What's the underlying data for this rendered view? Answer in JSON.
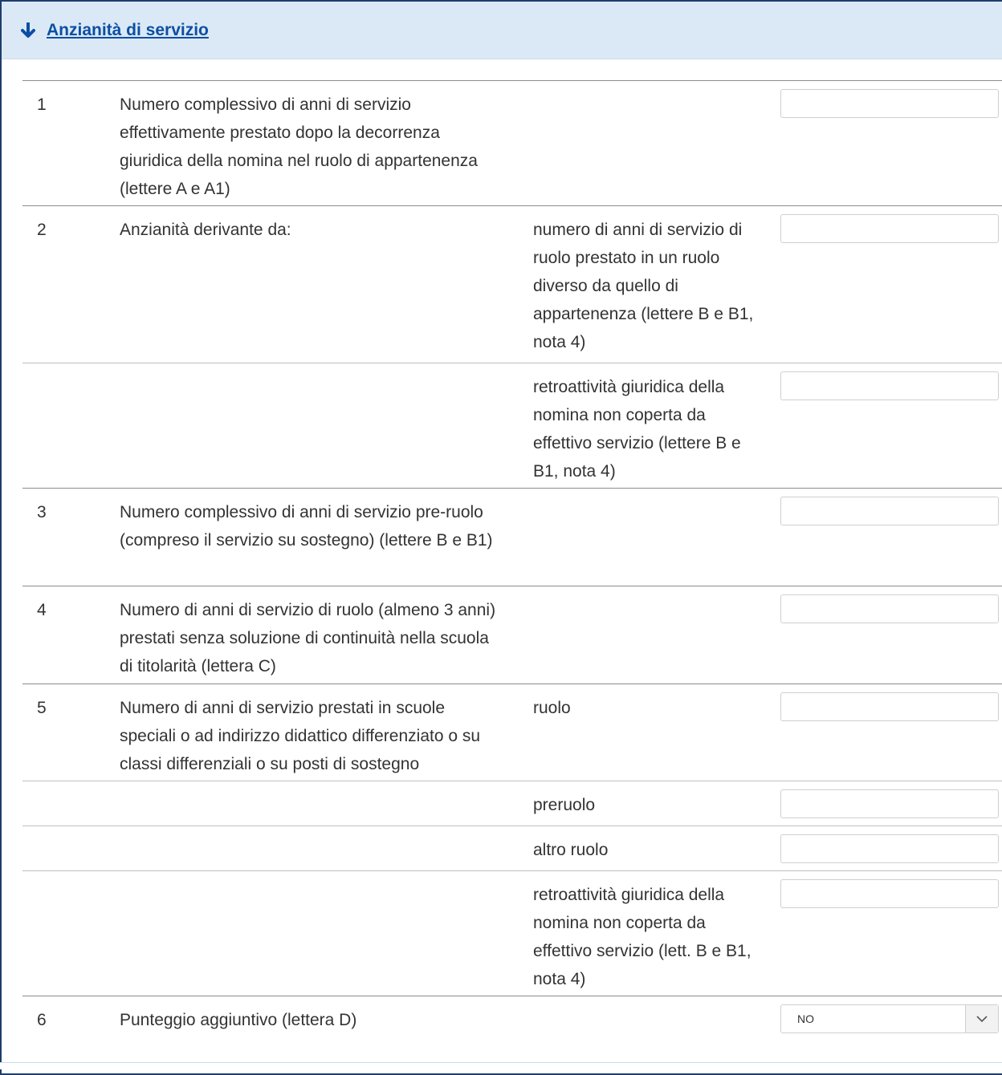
{
  "section": {
    "title": "Anzianità di servizio"
  },
  "rows": [
    {
      "num": "1",
      "desc": "Numero complessivo di anni di servizio effettivamente prestato dopo la decorrenza giuridica della nomina nel ruolo di appartenenza (lettere A e A1)",
      "sub": "",
      "value": ""
    },
    {
      "num": "2",
      "desc": "Anzianità derivante da:",
      "sub": "numero di anni di servizio di ruolo prestato in un ruolo diverso da quello di appartenenza (lettere B e B1, nota 4)",
      "value": ""
    },
    {
      "num": "",
      "desc": "",
      "sub": "retroattività giuridica della nomina non coperta da effettivo servizio (lettere B e B1, nota 4)",
      "value": ""
    },
    {
      "num": "3",
      "desc": "Numero complessivo di anni di servizio pre-ruolo (compreso il servizio su sostegno) (lettere B e B1)",
      "sub": "",
      "value": ""
    },
    {
      "num": "4",
      "desc": "Numero di anni di servizio di ruolo (almeno 3 anni) prestati senza soluzione di continuità nella scuola di titolarità (lettera C)",
      "sub": "",
      "value": ""
    },
    {
      "num": "5",
      "desc": "Numero di anni di servizio prestati in scuole speciali o ad indirizzo didattico differenziato o su classi differenziali o su posti di sostegno",
      "sub": "ruolo",
      "value": ""
    },
    {
      "num": "",
      "desc": "",
      "sub": "preruolo",
      "value": ""
    },
    {
      "num": "",
      "desc": "",
      "sub": "altro ruolo",
      "value": ""
    },
    {
      "num": "",
      "desc": "",
      "sub": "retroattività giuridica della nomina non coperta da effettivo servizio (lett. B e B1, nota 4)",
      "value": ""
    },
    {
      "num": "6",
      "desc": "Punteggio aggiuntivo (lettera D)",
      "sub": "",
      "select_value": "NO"
    }
  ],
  "icons": {
    "header": "arrow-down-icon",
    "select": "chevron-down-icon"
  },
  "colors": {
    "header_bg": "#dbe9f6",
    "link": "#0b4fa3",
    "border": "#1f3d6b"
  }
}
